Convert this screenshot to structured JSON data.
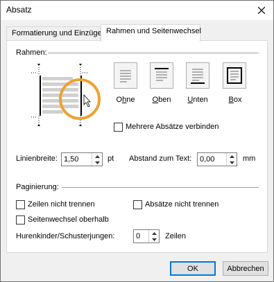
{
  "window": {
    "title": "Absatz"
  },
  "tabs": [
    {
      "label": "Formatierung und Einzüge"
    },
    {
      "label": "Rahmen und Seitenwechsel"
    }
  ],
  "borders": {
    "group_label": "Rahmen:",
    "presets": [
      {
        "label": "Ohne",
        "underline": "h"
      },
      {
        "label": "Oben",
        "underline": "O"
      },
      {
        "label": "Unten",
        "underline": "U"
      },
      {
        "label": "Box",
        "underline": "B"
      }
    ],
    "merge_label": "Mehrere Absätze verbinden",
    "merge_checked": false,
    "line_width_label": "Linienbreite:",
    "line_width_value": "1,50",
    "line_width_unit": "pt",
    "distance_label": "Abstand zum Text:",
    "distance_value": "0,00",
    "distance_unit": "mm",
    "highlight_color": "#f0a030"
  },
  "pagination": {
    "group_label": "Paginierung:",
    "keep_lines_label": "Zeilen nicht trennen",
    "keep_paragraphs_label": "Absätze nicht trennen",
    "page_break_label": "Seitenwechsel oberhalb",
    "orphans_label": "Hurenkinder/Schusterjungen:",
    "orphans_value": "0",
    "orphans_unit": "Zeilen"
  },
  "buttons": {
    "ok": "OK",
    "cancel": "Abbrechen"
  }
}
